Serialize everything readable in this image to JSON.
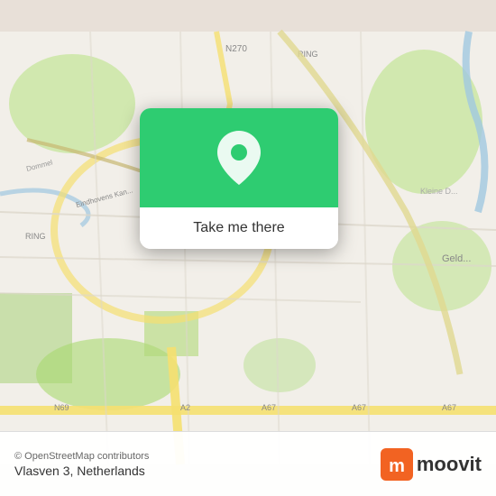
{
  "map": {
    "background_color": "#e8e0d8",
    "center_lat": 51.43,
    "center_lon": 5.47
  },
  "popup": {
    "button_label": "Take me there",
    "pin_icon": "📍"
  },
  "bottom_bar": {
    "attribution": "© OpenStreetMap contributors",
    "location_label": "Vlasven 3, Netherlands",
    "logo_text": "moovit"
  }
}
